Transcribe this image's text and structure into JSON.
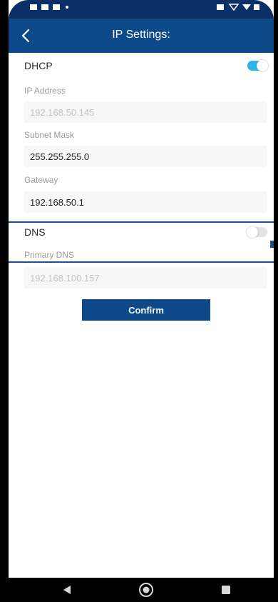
{
  "header": {
    "title": "IP Settings:"
  },
  "dhcp": {
    "label": "DHCP",
    "enabled": true
  },
  "ip_address": {
    "label": "IP Address",
    "value": "192.168.50.145"
  },
  "subnet_mask": {
    "label": "Subnet Mask",
    "value": "255.255.255.0"
  },
  "gateway": {
    "label": "Gateway",
    "value": "192.168.50.1"
  },
  "dns": {
    "label": "DNS",
    "enabled": false
  },
  "primary_dns": {
    "label": "Primary DNS",
    "value": "192.168.100.157"
  },
  "confirm": {
    "label": "Confirm"
  },
  "colors": {
    "header": "#0e4a8a",
    "toggle_on": "#29b6e8",
    "highlight": "#1d4f8f"
  },
  "icons": {
    "back": "chevron-left-icon",
    "nav_back": "triangle-back-icon",
    "nav_home": "circle-home-icon",
    "nav_recents": "square-recents-icon"
  }
}
